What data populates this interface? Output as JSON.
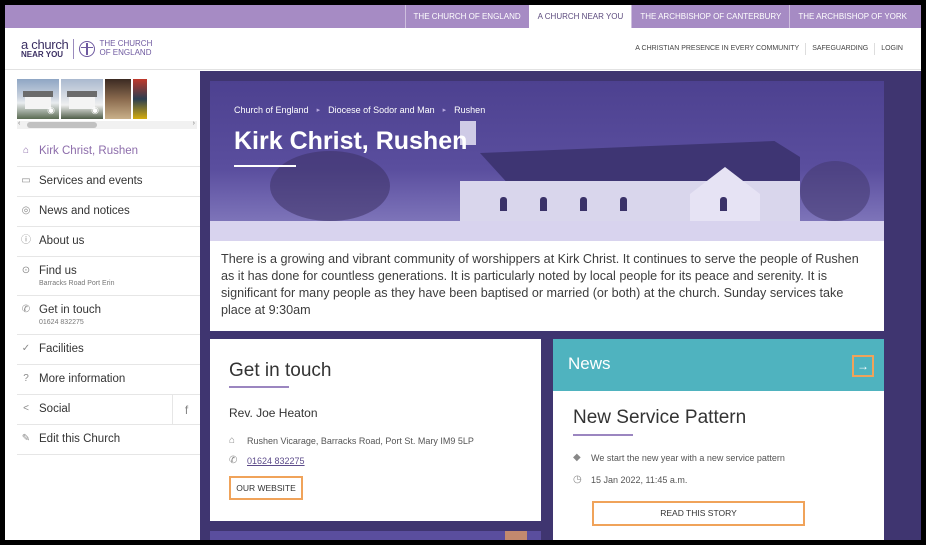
{
  "topbar": {
    "links": [
      {
        "label": "THE CHURCH OF ENGLAND",
        "active": false
      },
      {
        "label": "A CHURCH NEAR YOU",
        "active": true
      },
      {
        "label": "THE ARCHBISHOP OF CANTERBURY",
        "active": false
      },
      {
        "label": "THE ARCHBISHOP OF YORK",
        "active": false
      }
    ]
  },
  "header": {
    "logo": {
      "acny_line1": "a church",
      "acny_line2": "NEAR YOU",
      "coe_line1": "THE CHURCH",
      "coe_line2": "OF ENGLAND"
    },
    "links": [
      "A CHRISTIAN PRESENCE IN EVERY COMMUNITY",
      "SAFEGUARDING",
      "LOGIN"
    ]
  },
  "sidebar": {
    "items": [
      {
        "label": "Kirk Christ, Rushen",
        "sub": "",
        "icon": "home-icon",
        "active": true
      },
      {
        "label": "Services and events",
        "sub": "",
        "icon": "calendar-icon",
        "active": false
      },
      {
        "label": "News and notices",
        "sub": "",
        "icon": "broadcast-icon",
        "active": false
      },
      {
        "label": "About us",
        "sub": "",
        "icon": "info-icon",
        "active": false
      },
      {
        "label": "Find us",
        "sub": "Barracks Road Port Erin",
        "icon": "compass-icon",
        "active": false
      },
      {
        "label": "Get in touch",
        "sub": "01624 832275",
        "icon": "phone-icon",
        "active": false
      },
      {
        "label": "Facilities",
        "sub": "",
        "icon": "check-circle-icon",
        "active": false
      },
      {
        "label": "More information",
        "sub": "",
        "icon": "question-icon",
        "active": false
      },
      {
        "label": "Social",
        "sub": "",
        "icon": "share-icon",
        "active": false
      },
      {
        "label": "Edit this Church",
        "sub": "",
        "icon": "pencil-icon",
        "active": false
      }
    ],
    "facebook_glyph": "f"
  },
  "hero": {
    "breadcrumb": [
      "Church of England",
      "Diocese of Sodor and Man",
      "Rushen"
    ],
    "title": "Kirk Christ, Rushen"
  },
  "intro": {
    "text": "There is a growing and vibrant community of worshippers at Kirk Christ. It continues to serve the people of Rushen as it has done for countless generations. It is particularly noted by local people for its peace and serenity. It is significant for many people as they have been baptised or married (or both) at the church. Sunday services take place at 9:30am"
  },
  "get_in_touch": {
    "title": "Get in touch",
    "person": "Rev. Joe Heaton",
    "address": "Rushen Vicarage, Barracks Road, Port St. Mary IM9 5LP",
    "phone": "01624 832275",
    "website_button": "OUR WEBSITE"
  },
  "news": {
    "heading": "News",
    "arrow_glyph": "→",
    "story_title": "New Service Pattern",
    "story_summary": "We start the new year with a new service pattern",
    "story_date": "15 Jan 2022, 11:45 a.m.",
    "read_button": "READ THIS STORY"
  },
  "colors": {
    "topbar": "#a68bc4",
    "main_bg": "#3f3570",
    "news_header": "#4fb3bf",
    "button_outline": "#f0a35a",
    "active_nav": "#8d6dab"
  }
}
